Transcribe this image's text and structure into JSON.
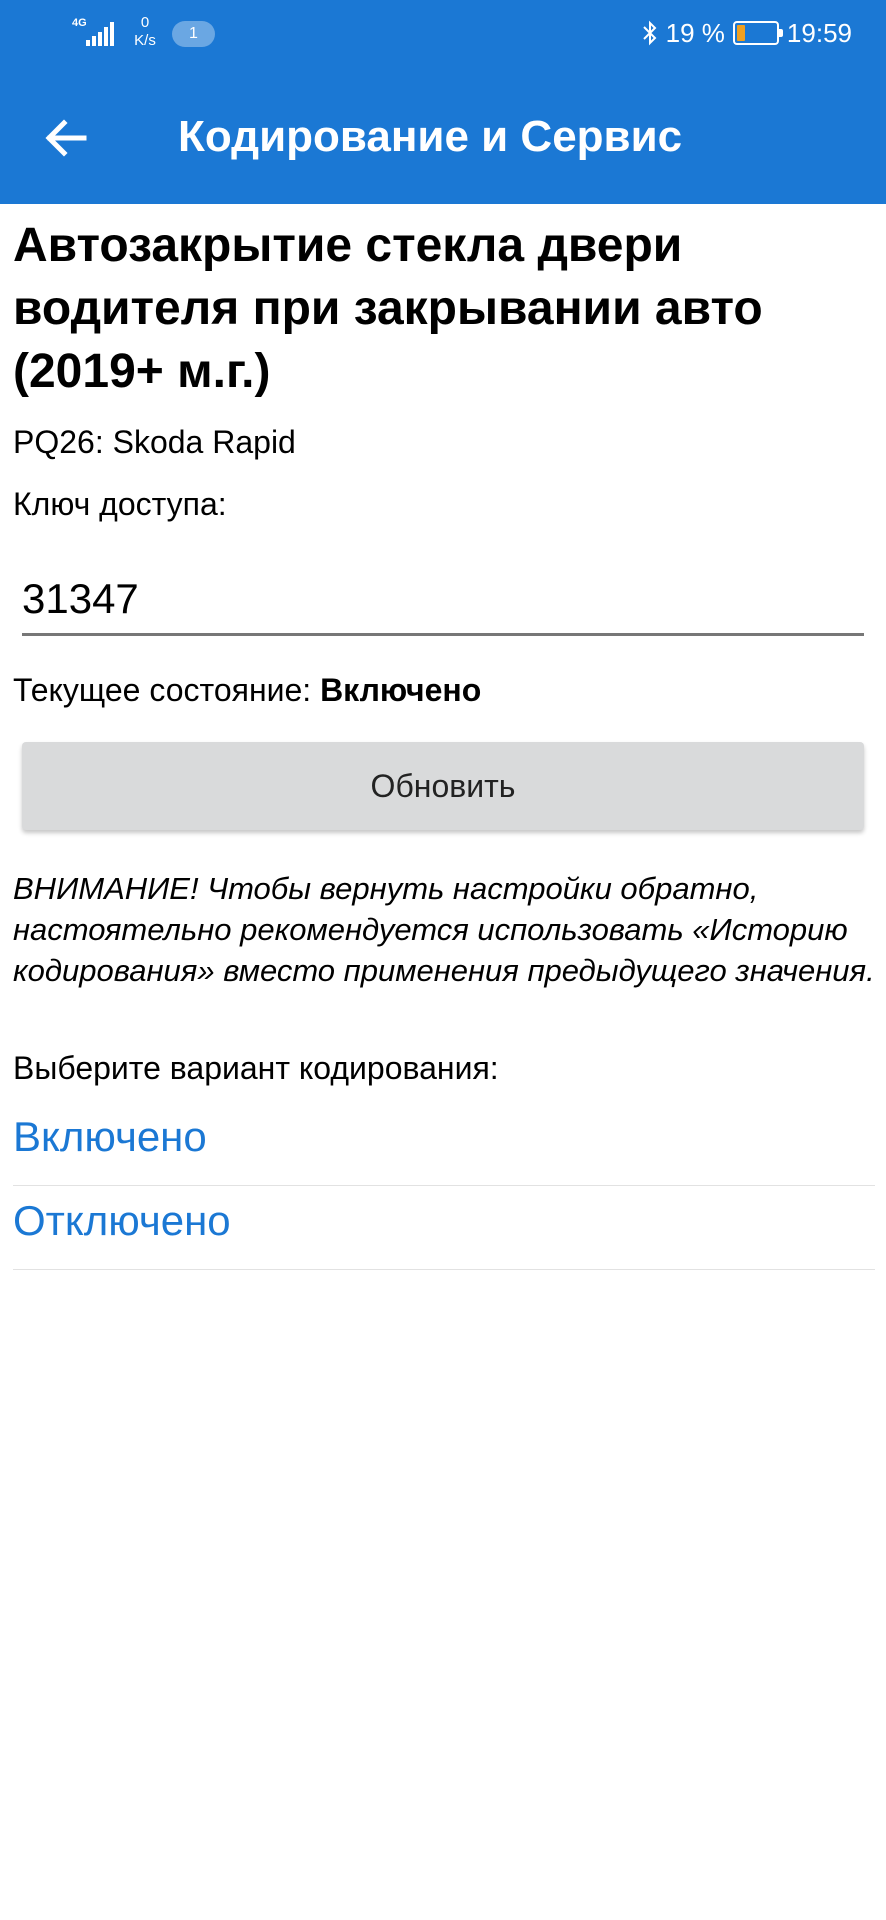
{
  "status_bar": {
    "network": "4G",
    "speed_value": "0",
    "speed_unit": "K/s",
    "notification_count": "1",
    "battery_percent": "19 %",
    "battery_level": 0.19,
    "time": "19:59"
  },
  "app_bar": {
    "back_icon": "arrow-left-icon",
    "title": "Кодирование и Сервис"
  },
  "page": {
    "title": "Автозакрытие стекла двери водителя при закрывании авто (2019+ м.г.)",
    "car_model": "PQ26: Skoda Rapid",
    "access_key_label": "Ключ доступа:",
    "access_key_value": "31347",
    "current_state_label": "Текущее состояние:",
    "current_state_value": "Включено",
    "refresh_button": "Обновить",
    "warning": "ВНИМАНИЕ! Чтобы вернуть настройки обратно, настоятельно рекомендуется использовать «Историю кодирования» вместо применения предыдущего значения.",
    "choose_label": "Выберите вариант кодирования:",
    "options": [
      "Включено",
      "Отключено"
    ]
  },
  "colors": {
    "header_bg": "#1b78d4",
    "option_text": "#1b78d4",
    "button_bg": "#d9dadb",
    "battery_fill": "#f0a020"
  }
}
